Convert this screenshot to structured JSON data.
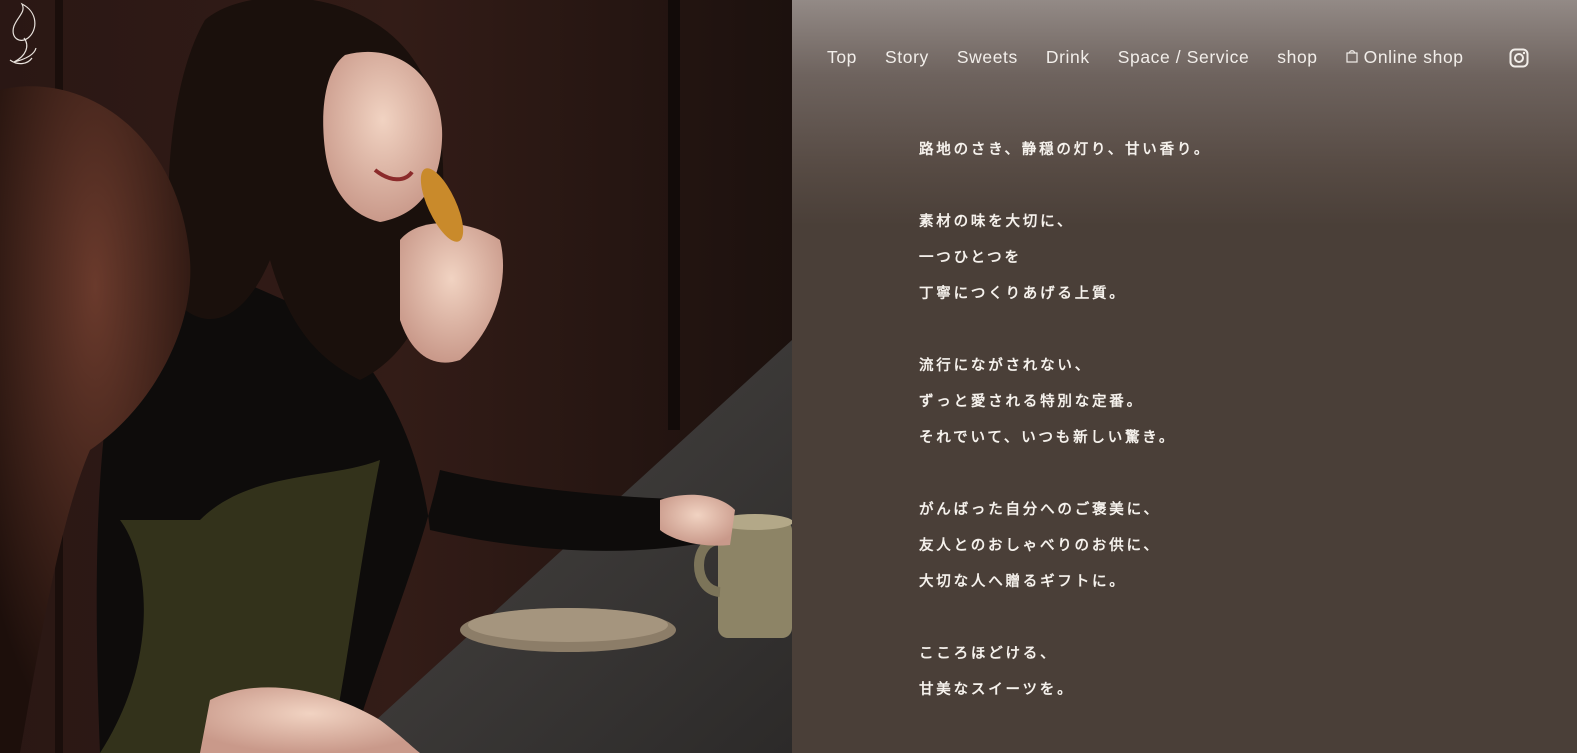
{
  "nav": {
    "items": [
      {
        "label": "Top",
        "name": "nav-top"
      },
      {
        "label": "Story",
        "name": "nav-story"
      },
      {
        "label": "Sweets",
        "name": "nav-sweets"
      },
      {
        "label": "Drink",
        "name": "nav-drink"
      },
      {
        "label": "Space / Service",
        "name": "nav-space-service"
      },
      {
        "label": "shop",
        "name": "nav-shop"
      }
    ],
    "online_shop_label": "Online shop",
    "online_shop_icon": "shopping-bag-icon",
    "instagram_icon": "instagram-icon"
  },
  "logo": {
    "icon": "flame-logo-icon"
  },
  "hero_photo": {
    "subject": "photo-woman-eating-madeleine"
  },
  "copy": {
    "stanza1": [
      "路地のさき、静穏の灯り、甘い香り。"
    ],
    "stanza2": [
      "素材の味を大切に、",
      "一つひとつを",
      "丁寧につくりあげる上質。"
    ],
    "stanza3": [
      "流行にながされない、",
      "ずっと愛される特別な定番。",
      "それでいて、いつも新しい驚き。"
    ],
    "stanza4": [
      "がんばった自分へのご褒美に、",
      "友人とのおしゃべりのお供に、",
      "大切な人へ贈るギフトに。"
    ],
    "stanza5": [
      "こころほどける、",
      "甘美なスイーツを。"
    ]
  },
  "colors": {
    "panel_bg": "#4a3f38",
    "panel_top": "#938a86",
    "text": "#f5f1ec"
  }
}
